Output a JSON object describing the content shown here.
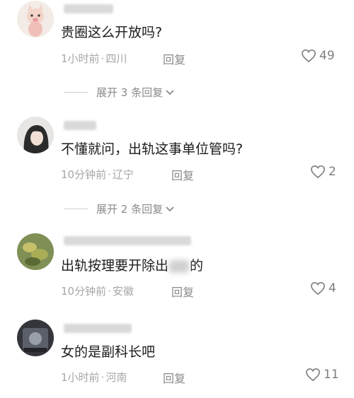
{
  "comments": [
    {
      "text": "贵圈这么开放吗?",
      "time": "1小时前",
      "location": "四川",
      "reply_label": "回复",
      "likes": "49"
    },
    {
      "text": "不懂就问，出轨这事单位管吗?",
      "time": "10分钟前",
      "location": "辽宁",
      "reply_label": "回复",
      "likes": "2"
    },
    {
      "text_before": "出轨按理要开除出",
      "text_after": "的",
      "time": "10分钟前",
      "location": "安徽",
      "reply_label": "回复",
      "likes": "4"
    },
    {
      "text": "女的是副科长吧",
      "time": "1小时前",
      "location": "河南",
      "reply_label": "回复",
      "likes": "11"
    }
  ],
  "expand_links": [
    {
      "label": "展开 3 条回复"
    },
    {
      "label": "展开 2 条回复"
    }
  ],
  "meta_separator": "·",
  "icons": {
    "like": "heart-outline-icon",
    "expand": "chevron-down-icon"
  },
  "colors": {
    "meta": "#a6a6a6",
    "text": "#1b1b1b",
    "background": "#ffffff"
  }
}
